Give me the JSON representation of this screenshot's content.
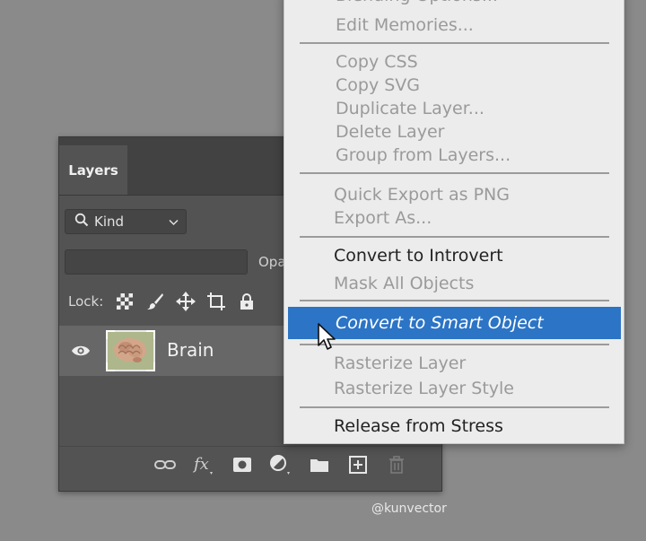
{
  "panel": {
    "tab_label": "Layers",
    "kind_label": "Kind",
    "opacity_label": "Opa",
    "lock_label": "Lock:",
    "layer_name": "Brain"
  },
  "menu": {
    "items": [
      {
        "label": "Blending Options...",
        "enabled": false
      },
      {
        "label": "Edit Memories...",
        "enabled": false
      },
      {
        "label": "Copy CSS",
        "enabled": false
      },
      {
        "label": "Copy SVG",
        "enabled": false
      },
      {
        "label": "Duplicate Layer...",
        "enabled": false
      },
      {
        "label": "Delete Layer",
        "enabled": false
      },
      {
        "label": "Group from Layers...",
        "enabled": false
      },
      {
        "label": "Quick Export as PNG",
        "enabled": false
      },
      {
        "label": "Export As...",
        "enabled": false
      },
      {
        "label": "Convert to Introvert",
        "enabled": true
      },
      {
        "label": "Mask All Objects",
        "enabled": false
      },
      {
        "label": "Convert to Smart Object",
        "enabled": true,
        "highlighted": true
      },
      {
        "label": "Rasterize Layer",
        "enabled": false
      },
      {
        "label": "Rasterize Layer Style",
        "enabled": false
      },
      {
        "label": "Release from Stress",
        "enabled": true
      }
    ]
  },
  "watermark": "@kunvector",
  "colors": {
    "highlight": "#2c74c5",
    "panel_bg": "#535353",
    "menu_bg": "#ececec"
  }
}
